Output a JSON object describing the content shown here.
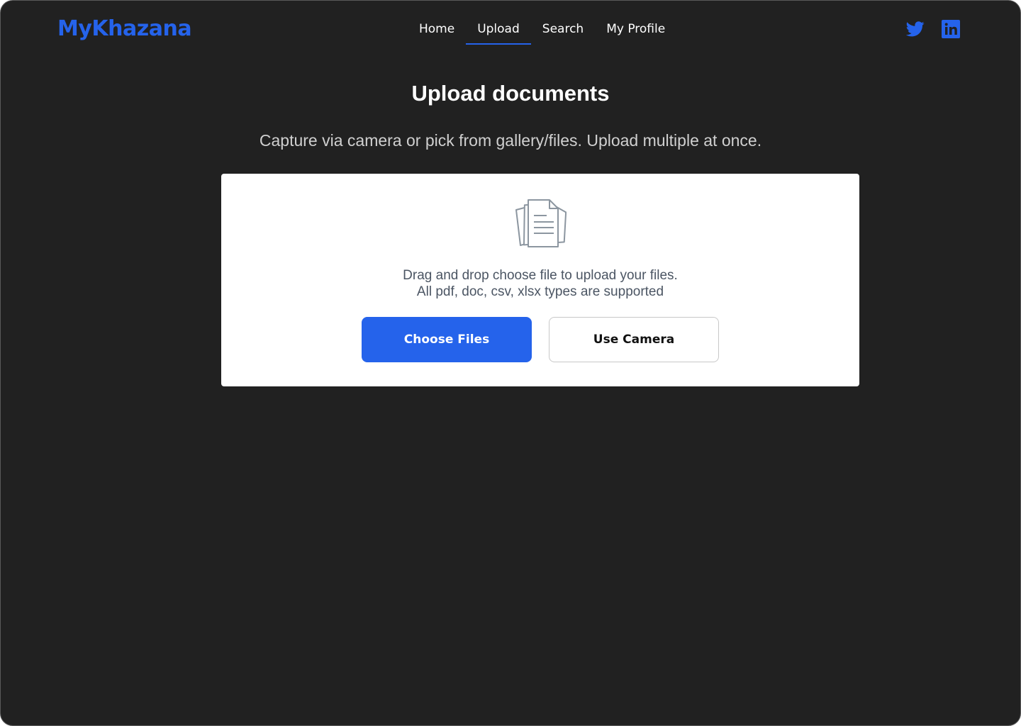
{
  "brand": {
    "name": "MyKhazana",
    "color": "#2563eb"
  },
  "nav": {
    "items": [
      {
        "label": "Home",
        "active": false
      },
      {
        "label": "Upload",
        "active": true
      },
      {
        "label": "Search",
        "active": false
      },
      {
        "label": "My Profile",
        "active": false
      }
    ]
  },
  "social": {
    "icons": [
      "twitter-icon",
      "linkedin-icon"
    ]
  },
  "page": {
    "title": "Upload documents",
    "subtitle": "Capture via camera or pick from gallery/files. Upload multiple at once."
  },
  "upload": {
    "icon": "documents-icon",
    "instructions_line1": "Drag and drop choose file to upload your files.",
    "instructions_line2": "All pdf, doc, csv, xlsx types are supported",
    "choose_files_label": "Choose Files",
    "use_camera_label": "Use Camera"
  },
  "colors": {
    "background": "#212121",
    "accent": "#2563eb",
    "card": "#ffffff"
  }
}
